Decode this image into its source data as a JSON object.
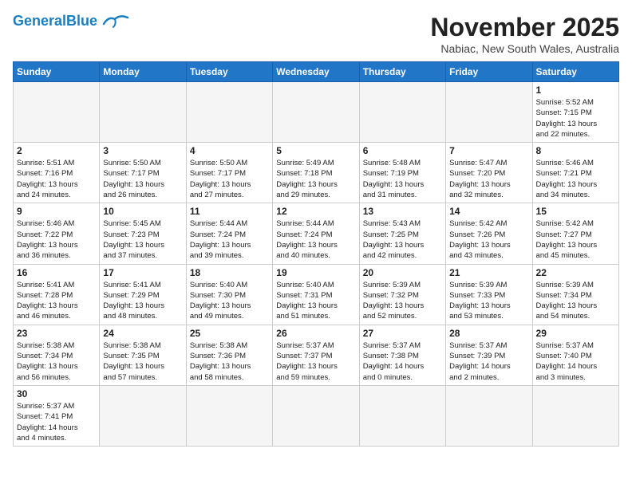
{
  "header": {
    "logo_general": "General",
    "logo_blue": "Blue",
    "month_title": "November 2025",
    "location": "Nabiac, New South Wales, Australia"
  },
  "weekdays": [
    "Sunday",
    "Monday",
    "Tuesday",
    "Wednesday",
    "Thursday",
    "Friday",
    "Saturday"
  ],
  "weeks": [
    [
      {
        "day": "",
        "info": ""
      },
      {
        "day": "",
        "info": ""
      },
      {
        "day": "",
        "info": ""
      },
      {
        "day": "",
        "info": ""
      },
      {
        "day": "",
        "info": ""
      },
      {
        "day": "",
        "info": ""
      },
      {
        "day": "1",
        "info": "Sunrise: 5:52 AM\nSunset: 7:15 PM\nDaylight: 13 hours\nand 22 minutes."
      }
    ],
    [
      {
        "day": "2",
        "info": "Sunrise: 5:51 AM\nSunset: 7:16 PM\nDaylight: 13 hours\nand 24 minutes."
      },
      {
        "day": "3",
        "info": "Sunrise: 5:50 AM\nSunset: 7:17 PM\nDaylight: 13 hours\nand 26 minutes."
      },
      {
        "day": "4",
        "info": "Sunrise: 5:50 AM\nSunset: 7:17 PM\nDaylight: 13 hours\nand 27 minutes."
      },
      {
        "day": "5",
        "info": "Sunrise: 5:49 AM\nSunset: 7:18 PM\nDaylight: 13 hours\nand 29 minutes."
      },
      {
        "day": "6",
        "info": "Sunrise: 5:48 AM\nSunset: 7:19 PM\nDaylight: 13 hours\nand 31 minutes."
      },
      {
        "day": "7",
        "info": "Sunrise: 5:47 AM\nSunset: 7:20 PM\nDaylight: 13 hours\nand 32 minutes."
      },
      {
        "day": "8",
        "info": "Sunrise: 5:46 AM\nSunset: 7:21 PM\nDaylight: 13 hours\nand 34 minutes."
      }
    ],
    [
      {
        "day": "9",
        "info": "Sunrise: 5:46 AM\nSunset: 7:22 PM\nDaylight: 13 hours\nand 36 minutes."
      },
      {
        "day": "10",
        "info": "Sunrise: 5:45 AM\nSunset: 7:23 PM\nDaylight: 13 hours\nand 37 minutes."
      },
      {
        "day": "11",
        "info": "Sunrise: 5:44 AM\nSunset: 7:24 PM\nDaylight: 13 hours\nand 39 minutes."
      },
      {
        "day": "12",
        "info": "Sunrise: 5:44 AM\nSunset: 7:24 PM\nDaylight: 13 hours\nand 40 minutes."
      },
      {
        "day": "13",
        "info": "Sunrise: 5:43 AM\nSunset: 7:25 PM\nDaylight: 13 hours\nand 42 minutes."
      },
      {
        "day": "14",
        "info": "Sunrise: 5:42 AM\nSunset: 7:26 PM\nDaylight: 13 hours\nand 43 minutes."
      },
      {
        "day": "15",
        "info": "Sunrise: 5:42 AM\nSunset: 7:27 PM\nDaylight: 13 hours\nand 45 minutes."
      }
    ],
    [
      {
        "day": "16",
        "info": "Sunrise: 5:41 AM\nSunset: 7:28 PM\nDaylight: 13 hours\nand 46 minutes."
      },
      {
        "day": "17",
        "info": "Sunrise: 5:41 AM\nSunset: 7:29 PM\nDaylight: 13 hours\nand 48 minutes."
      },
      {
        "day": "18",
        "info": "Sunrise: 5:40 AM\nSunset: 7:30 PM\nDaylight: 13 hours\nand 49 minutes."
      },
      {
        "day": "19",
        "info": "Sunrise: 5:40 AM\nSunset: 7:31 PM\nDaylight: 13 hours\nand 51 minutes."
      },
      {
        "day": "20",
        "info": "Sunrise: 5:39 AM\nSunset: 7:32 PM\nDaylight: 13 hours\nand 52 minutes."
      },
      {
        "day": "21",
        "info": "Sunrise: 5:39 AM\nSunset: 7:33 PM\nDaylight: 13 hours\nand 53 minutes."
      },
      {
        "day": "22",
        "info": "Sunrise: 5:39 AM\nSunset: 7:34 PM\nDaylight: 13 hours\nand 54 minutes."
      }
    ],
    [
      {
        "day": "23",
        "info": "Sunrise: 5:38 AM\nSunset: 7:34 PM\nDaylight: 13 hours\nand 56 minutes."
      },
      {
        "day": "24",
        "info": "Sunrise: 5:38 AM\nSunset: 7:35 PM\nDaylight: 13 hours\nand 57 minutes."
      },
      {
        "day": "25",
        "info": "Sunrise: 5:38 AM\nSunset: 7:36 PM\nDaylight: 13 hours\nand 58 minutes."
      },
      {
        "day": "26",
        "info": "Sunrise: 5:37 AM\nSunset: 7:37 PM\nDaylight: 13 hours\nand 59 minutes."
      },
      {
        "day": "27",
        "info": "Sunrise: 5:37 AM\nSunset: 7:38 PM\nDaylight: 14 hours\nand 0 minutes."
      },
      {
        "day": "28",
        "info": "Sunrise: 5:37 AM\nSunset: 7:39 PM\nDaylight: 14 hours\nand 2 minutes."
      },
      {
        "day": "29",
        "info": "Sunrise: 5:37 AM\nSunset: 7:40 PM\nDaylight: 14 hours\nand 3 minutes."
      }
    ],
    [
      {
        "day": "30",
        "info": "Sunrise: 5:37 AM\nSunset: 7:41 PM\nDaylight: 14 hours\nand 4 minutes."
      },
      {
        "day": "",
        "info": ""
      },
      {
        "day": "",
        "info": ""
      },
      {
        "day": "",
        "info": ""
      },
      {
        "day": "",
        "info": ""
      },
      {
        "day": "",
        "info": ""
      },
      {
        "day": "",
        "info": ""
      }
    ]
  ]
}
